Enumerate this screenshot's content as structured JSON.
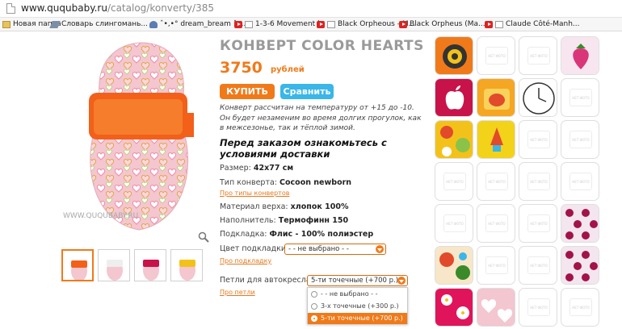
{
  "address_bar": {
    "domain": "www.ququbaby.ru",
    "path": "/catalog/konverty/385"
  },
  "bookmarks": [
    {
      "label": "Новая папка",
      "icon": "folder-icon"
    },
    {
      "label": "Словарь слингомань...",
      "icon": "pen-icon"
    },
    {
      "label": "ˆ•‚•° dream_bream ˆ•...",
      "icon": "user-icon"
    },
    {
      "label": "1-3-6 Movement in ...",
      "icon": "youtube-icon"
    },
    {
      "label": "Black Orpheous - M...",
      "icon": "youtube-icon"
    },
    {
      "label": "Black Orpheus (Ma...",
      "icon": "youtube-icon"
    },
    {
      "label": "Claude Côté-Manh...",
      "icon": "youtube-icon"
    }
  ],
  "product": {
    "title": "КОНВЕРТ COLOR HEARTS",
    "price": "3750",
    "currency": "рублей",
    "buy_label": "КУПИТЬ",
    "compare_label": "Сравнить",
    "description": "Конверт рассчитан на температуру от  +15 до -10. Он будет незаменим во время долгих прогулок, как в межсезонье, так и тёплой зимой.",
    "notice": "Перед заказом ознакомьтесь с условиями доставки",
    "watermark": "WWW.QUQUBABY.RU",
    "specs": [
      {
        "label": "Размер:",
        "value": "42х77 см"
      },
      {
        "label": "Тип конверта:",
        "value": "Cocoon newborn"
      },
      {
        "label": "Материал верха:",
        "value": "хлопок 100%"
      },
      {
        "label": "Наполнитель:",
        "value": "Термофинн 150"
      },
      {
        "label": "Подкладка:",
        "value": "Флис - 100% полиэстер"
      }
    ],
    "links": {
      "envelope_types": "Про типы конвертов",
      "lining": "Про подкладку",
      "loops": "Про петли"
    },
    "lining_color": {
      "label": "Цвет подкладки:",
      "value": "- - не выбрано - -"
    },
    "car_seat_loops": {
      "label": "Петли для автокресла:",
      "value": "5-ти точечные (+700 р.)",
      "options": [
        "- - не выбрано - -",
        "3-х точечные (+300 р.)",
        "5-ти точечные (+700 р.)"
      ],
      "selected_index": 2
    }
  },
  "swatch_placeholder": "НЕТ ФОТО",
  "swatches": [
    "gears",
    "none",
    "none",
    "strawberry",
    "apple",
    "elephant",
    "clock",
    "none",
    "lemons",
    "rocket",
    "none",
    "none",
    "none",
    "none",
    "none",
    "none",
    "none",
    "none",
    "none",
    "dots",
    "birds",
    "none",
    "none",
    "dots",
    "flowers",
    "hearts",
    "none",
    "none"
  ],
  "colors": {
    "accent": "#f07a1a",
    "compare": "#3ab6e8",
    "title": "#9a9a9a"
  }
}
